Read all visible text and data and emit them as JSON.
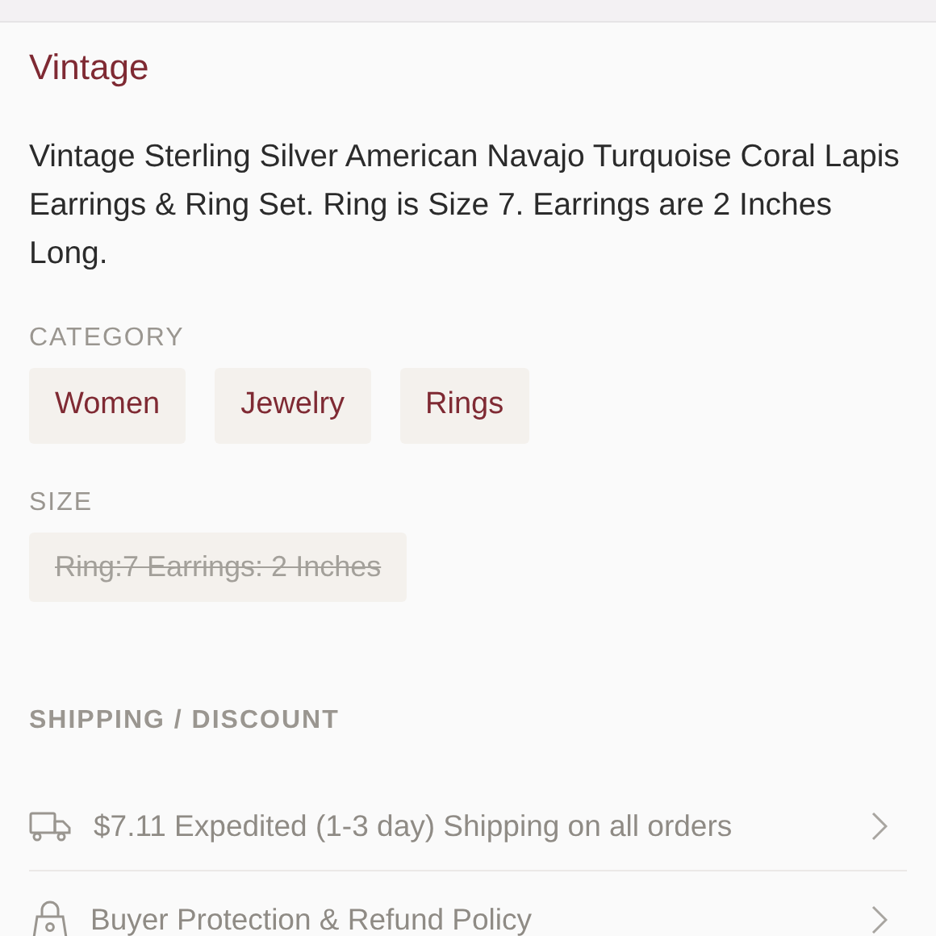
{
  "brand": "Vintage",
  "description": "Vintage Sterling Silver American Navajo Turquoise Coral Lapis Earrings & Ring Set. Ring is Size 7. Earrings are 2 Inches Long.",
  "category": {
    "label": "CATEGORY",
    "tags": [
      "Women",
      "Jewelry",
      "Rings"
    ]
  },
  "size": {
    "label": "SIZE",
    "options": [
      {
        "text": "Ring:7 Earrings: 2 Inches",
        "disabled": true
      }
    ]
  },
  "shipping": {
    "label": "SHIPPING / DISCOUNT",
    "rows": [
      {
        "kind": "truck",
        "text": "$7.11 Expedited (1-3 day) Shipping on all orders"
      },
      {
        "kind": "lock",
        "text": "Buyer Protection & Refund Policy"
      }
    ]
  }
}
